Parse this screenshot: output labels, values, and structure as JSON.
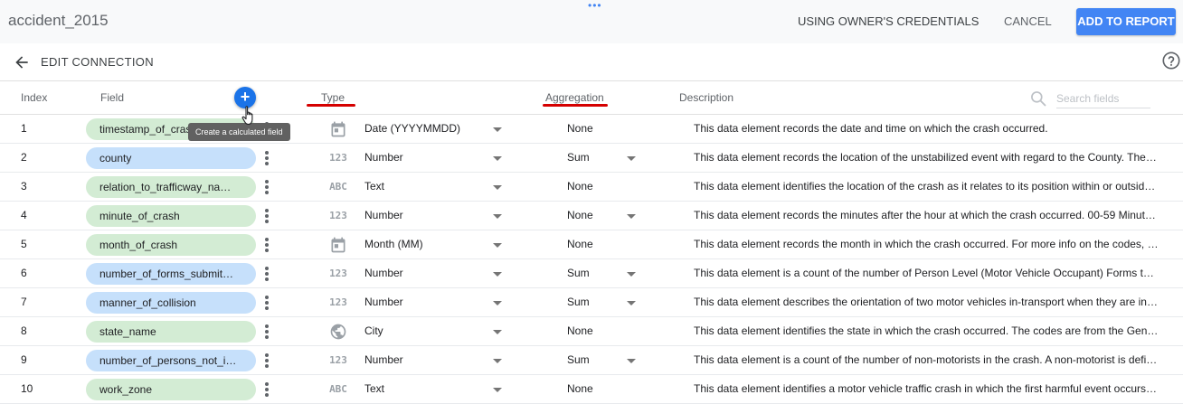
{
  "header": {
    "app_title": "accident_2015",
    "drag_handle": "•••",
    "credentials_label": "USING OWNER'S CREDENTIALS",
    "cancel_label": "CANCEL",
    "add_to_report_label": "ADD TO REPORT",
    "accent_color": "#4285f4"
  },
  "subheader": {
    "back_icon": "arrow-back-icon",
    "title": "EDIT CONNECTION",
    "help_icon": "help-circle-icon"
  },
  "columns": {
    "index": "Index",
    "field": "Field",
    "type": "Type",
    "aggregation": "Aggregation",
    "description": "Description"
  },
  "add_field": {
    "symbol": "+",
    "tooltip": "Create a calculated field"
  },
  "search": {
    "placeholder": "Search fields"
  },
  "rows": [
    {
      "index": "1",
      "field": "timestamp_of_crash",
      "kind": "dimension",
      "type_icon": "calendar-icon",
      "type": "Date (YYYYMMDD)",
      "aggregation": "None",
      "agg_dropdown": false,
      "description": "This data element records the date and time on which the crash occurred."
    },
    {
      "index": "2",
      "field": "county",
      "kind": "metric",
      "type_icon": "123",
      "type": "Number",
      "aggregation": "Sum",
      "agg_dropdown": true,
      "description": "This data element records the location of the unstabilized event with regard to the County. The …"
    },
    {
      "index": "3",
      "field": "relation_to_trafficway_na…",
      "kind": "dimension",
      "type_icon": "ABC",
      "type": "Text",
      "aggregation": "None",
      "agg_dropdown": false,
      "description": "This data element identifies the location of the crash as it relates to its position within or outsid…"
    },
    {
      "index": "4",
      "field": "minute_of_crash",
      "kind": "dimension",
      "type_icon": "123",
      "type": "Number",
      "aggregation": "None",
      "agg_dropdown": true,
      "description": "This data element records the minutes after the hour at which the crash occurred. 00-59 Minute…"
    },
    {
      "index": "5",
      "field": "month_of_crash",
      "kind": "dimension",
      "type_icon": "calendar-icon",
      "type": "Month (MM)",
      "aggregation": "None",
      "agg_dropdown": false,
      "description": "This data element records the month in which the crash occurred. For more info on the codes, p…"
    },
    {
      "index": "6",
      "field": "number_of_forms_submit…",
      "kind": "metric",
      "type_icon": "123",
      "type": "Number",
      "aggregation": "Sum",
      "agg_dropdown": true,
      "description": "This data element is a count of the number of Person Level (Motor Vehicle Occupant) Forms th…"
    },
    {
      "index": "7",
      "field": "manner_of_collision",
      "kind": "metric",
      "type_icon": "123",
      "type": "Number",
      "aggregation": "Sum",
      "agg_dropdown": true,
      "description": "This data element describes the orientation of two motor vehicles in-transport when they are inv…"
    },
    {
      "index": "8",
      "field": "state_name",
      "kind": "dimension",
      "type_icon": "globe-icon",
      "type": "City",
      "aggregation": "None",
      "agg_dropdown": false,
      "description": "This data element identifies the state in which the crash occurred. The codes are from the Gene…"
    },
    {
      "index": "9",
      "field": "number_of_persons_not_i…",
      "kind": "metric",
      "type_icon": "123",
      "type": "Number",
      "aggregation": "Sum",
      "agg_dropdown": true,
      "description": "This data element is a count of the number of non-motorists in the crash. A non-motorist is defi…"
    },
    {
      "index": "10",
      "field": "work_zone",
      "kind": "dimension",
      "type_icon": "ABC",
      "type": "Text",
      "aggregation": "None",
      "agg_dropdown": false,
      "description": "This data element identifies a motor vehicle traffic crash in which the first harmful event occurs …"
    }
  ]
}
